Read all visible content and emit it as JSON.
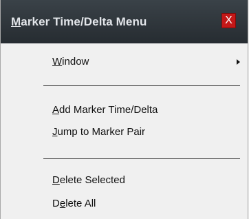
{
  "title_bar": {
    "title_underlined": "M",
    "title_rest": "arker Time/Delta Menu",
    "close_label": "X"
  },
  "menu": {
    "window": {
      "ul": "W",
      "rest": "indow"
    },
    "add": {
      "ul": "A",
      "rest": "dd Marker Time/Delta"
    },
    "jump": {
      "ul": "J",
      "rest": "ump to Marker Pair"
    },
    "delete_selected": {
      "ul": "D",
      "rest": "elete Selected"
    },
    "delete_all": {
      "pre": "D",
      "ul": "e",
      "rest": "lete All"
    }
  }
}
